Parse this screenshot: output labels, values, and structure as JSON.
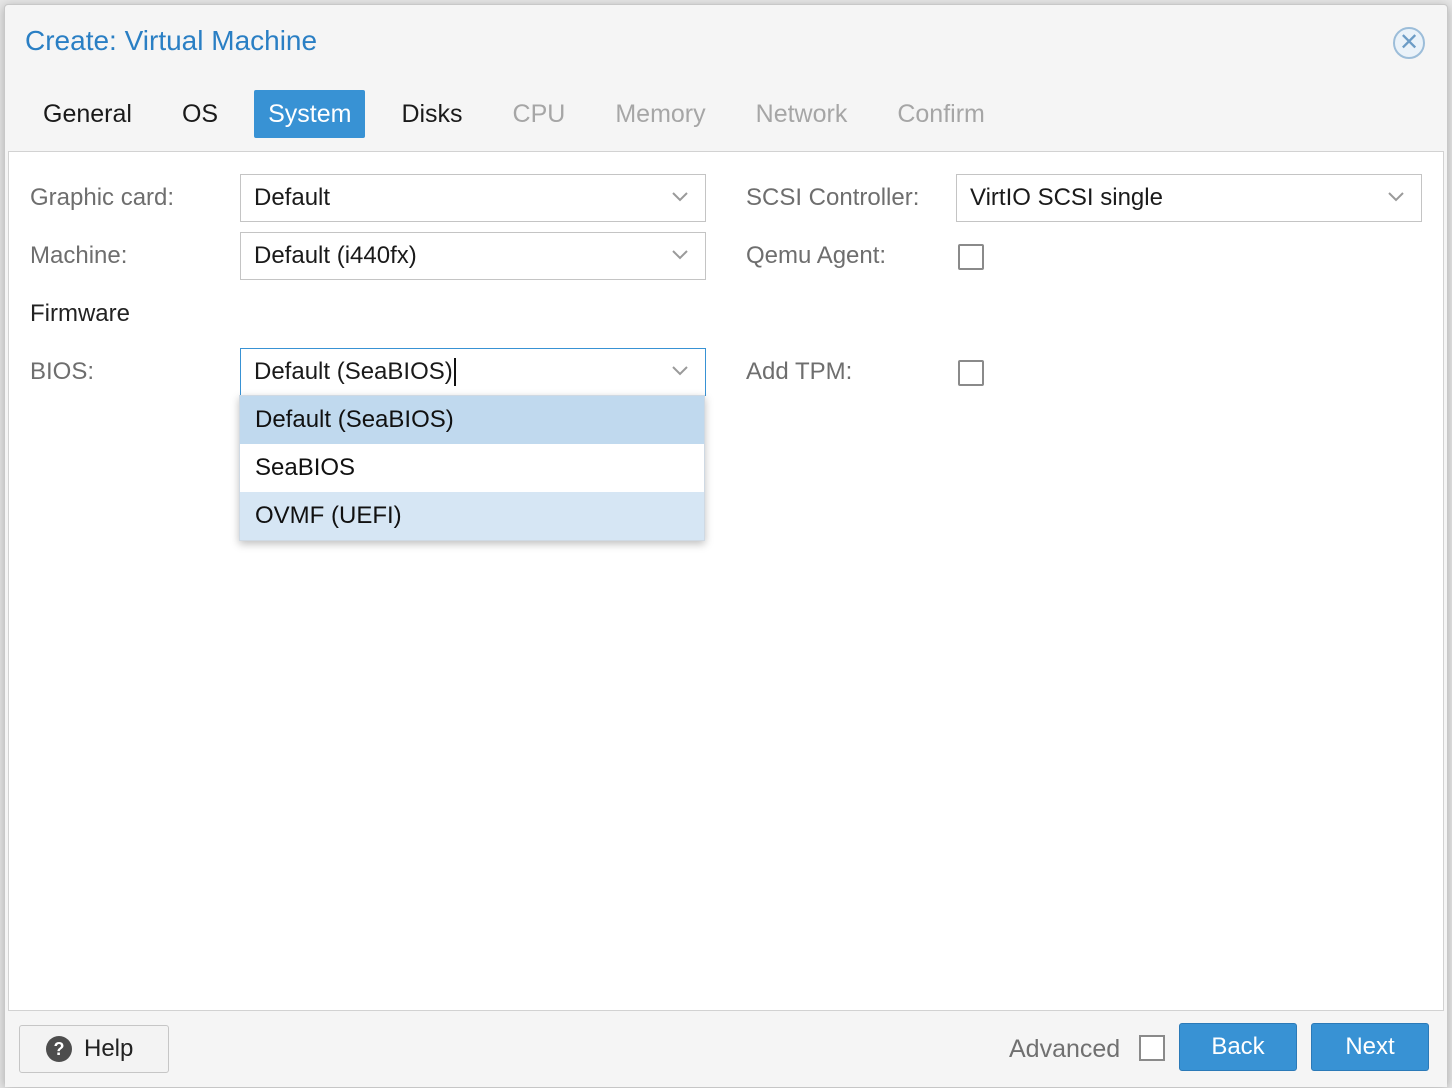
{
  "window": {
    "title": "Create: Virtual Machine",
    "close_icon": "close-icon"
  },
  "tabs": [
    {
      "label": "General",
      "state": "normal"
    },
    {
      "label": "OS",
      "state": "normal"
    },
    {
      "label": "System",
      "state": "active"
    },
    {
      "label": "Disks",
      "state": "normal"
    },
    {
      "label": "CPU",
      "state": "disabled"
    },
    {
      "label": "Memory",
      "state": "disabled"
    },
    {
      "label": "Network",
      "state": "disabled"
    },
    {
      "label": "Confirm",
      "state": "disabled"
    }
  ],
  "form": {
    "graphic_card": {
      "label": "Graphic card:",
      "value": "Default"
    },
    "machine": {
      "label": "Machine:",
      "value": "Default (i440fx)"
    },
    "firmware_section": "Firmware",
    "bios": {
      "label": "BIOS:",
      "value": "Default (SeaBIOS)"
    },
    "scsi_controller": {
      "label": "SCSI Controller:",
      "value": "VirtIO SCSI single"
    },
    "qemu_agent": {
      "label": "Qemu Agent:",
      "checked": false
    },
    "add_tpm": {
      "label": "Add TPM:",
      "checked": false
    }
  },
  "bios_dropdown": {
    "options": [
      "Default (SeaBIOS)",
      "SeaBIOS",
      "OVMF (UEFI)"
    ],
    "selected_index": 0,
    "hover_index": 2
  },
  "footer": {
    "help_label": "Help",
    "advanced_label": "Advanced",
    "advanced_checked": false,
    "back_label": "Back",
    "next_label": "Next"
  },
  "colors": {
    "accent": "#3892d4",
    "title": "#2a7fc4",
    "selected_option": "#c0d9ee",
    "hover_option": "#d6e6f4"
  }
}
